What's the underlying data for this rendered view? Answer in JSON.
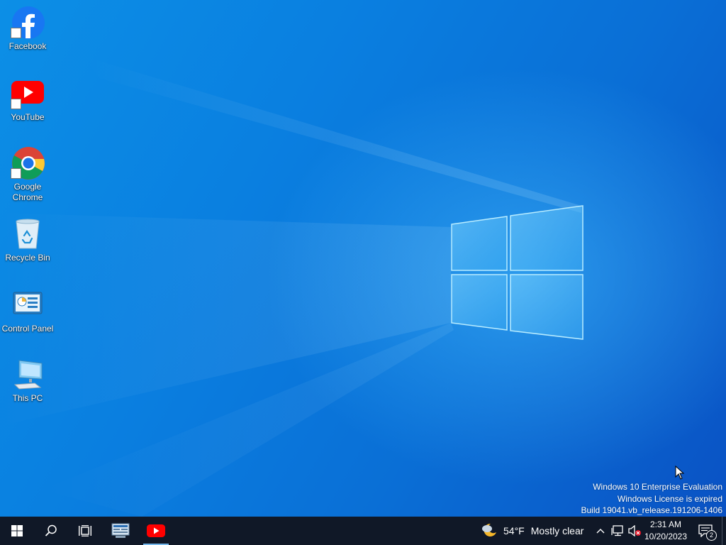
{
  "desktop": {
    "icons": [
      {
        "label": "Facebook",
        "icon": "facebook-icon",
        "shortcut": true
      },
      {
        "label": "YouTube",
        "icon": "youtube-icon",
        "shortcut": true
      },
      {
        "label_line1": "Google",
        "label_line2": "Chrome",
        "icon": "chrome-icon",
        "shortcut": true
      },
      {
        "label": "Recycle Bin",
        "icon": "recycle-bin-icon",
        "shortcut": false
      },
      {
        "label": "Control Panel",
        "icon": "control-panel-icon",
        "shortcut": false
      },
      {
        "label": "This PC",
        "icon": "this-pc-icon",
        "shortcut": false
      }
    ],
    "watermark": {
      "line1": "Windows 10 Enterprise Evaluation",
      "line2": "Windows License is expired",
      "line3": "Build 19041.vb_release.191206-1406"
    }
  },
  "taskbar": {
    "start_icon": "windows-start-icon",
    "search_icon": "search-icon",
    "task_view_icon": "task-view-icon",
    "pinned": [
      {
        "name": "network-app-icon",
        "active": false
      },
      {
        "name": "youtube-icon",
        "active": true
      }
    ],
    "weather": {
      "icon": "weather-moon-cloud-icon",
      "temp": "54°F",
      "condition": "Mostly clear"
    },
    "tray": {
      "overflow_icon": "chevron-up-icon",
      "network_icon": "network-icon",
      "volume_icon": "volume-muted-icon"
    },
    "clock": {
      "time": "2:31 AM",
      "date": "10/20/2023"
    },
    "notifications": {
      "icon": "action-center-icon",
      "count": "2"
    }
  },
  "colors": {
    "taskbar": "#101827",
    "desktop_blue": "#0a7fe0",
    "youtube_red": "#ff0000",
    "facebook_blue": "#1877f2"
  }
}
